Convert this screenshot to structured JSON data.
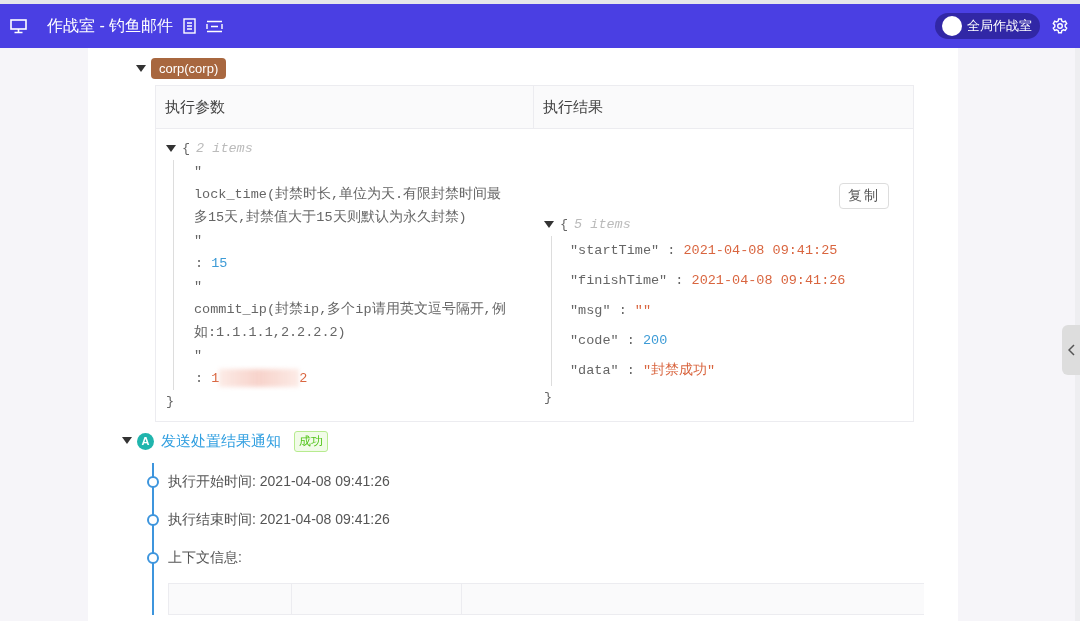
{
  "header": {
    "title": "作战室 - 钓鱼邮件",
    "toggle": {
      "label": "全局作战室",
      "on": false
    }
  },
  "node": {
    "expanded": true,
    "badge": "corp(corp)",
    "columns": [
      "执行参数",
      "执行结果"
    ],
    "params": {
      "expanded": true,
      "open": "{",
      "summary": "2 items",
      "close": "}",
      "entries": [
        {
          "quote_open": "\"",
          "key": "lock_time(封禁时长,单位为天.有限封禁时间最多15天,封禁值大于15天则默认为永久封禁)",
          "quote_close": "\"",
          "separator": ":",
          "kind": "number",
          "value": "15"
        },
        {
          "quote_open": "\"",
          "key": "commit_ip(封禁ip,多个ip请用英文逗号隔开,例如:1.1.1.1,2.2.2.2)",
          "quote_close": "\"",
          "separator": ":",
          "kind": "redacted",
          "value": "1",
          "value_end": "2"
        }
      ]
    },
    "result": {
      "copy_button": "复制",
      "expanded": true,
      "open": "{",
      "summary": "5 items",
      "close": "}",
      "entries": [
        {
          "key": "\"startTime\"",
          "separator": ":",
          "kind": "string",
          "value": "2021-04-08 09:41:25"
        },
        {
          "key": "\"finishTime\"",
          "separator": ":",
          "kind": "string",
          "value": "2021-04-08 09:41:26"
        },
        {
          "key": "\"msg\"",
          "separator": ":",
          "kind": "string",
          "value": "\"\""
        },
        {
          "key": "\"code\"",
          "separator": ":",
          "kind": "number",
          "value": "200"
        },
        {
          "key": "\"data\"",
          "separator": ":",
          "kind": "string",
          "value": "\"封禁成功\""
        }
      ]
    }
  },
  "step": {
    "expanded": true,
    "avatar": "A",
    "title": "发送处置结果通知",
    "status": {
      "label": "成功",
      "kind": "success"
    },
    "timeline": [
      {
        "text": "执行开始时间: 2021-04-08 09:41:26"
      },
      {
        "text": "执行结束时间: 2021-04-08 09:41:26"
      },
      {
        "text": "上下文信息:"
      }
    ]
  }
}
